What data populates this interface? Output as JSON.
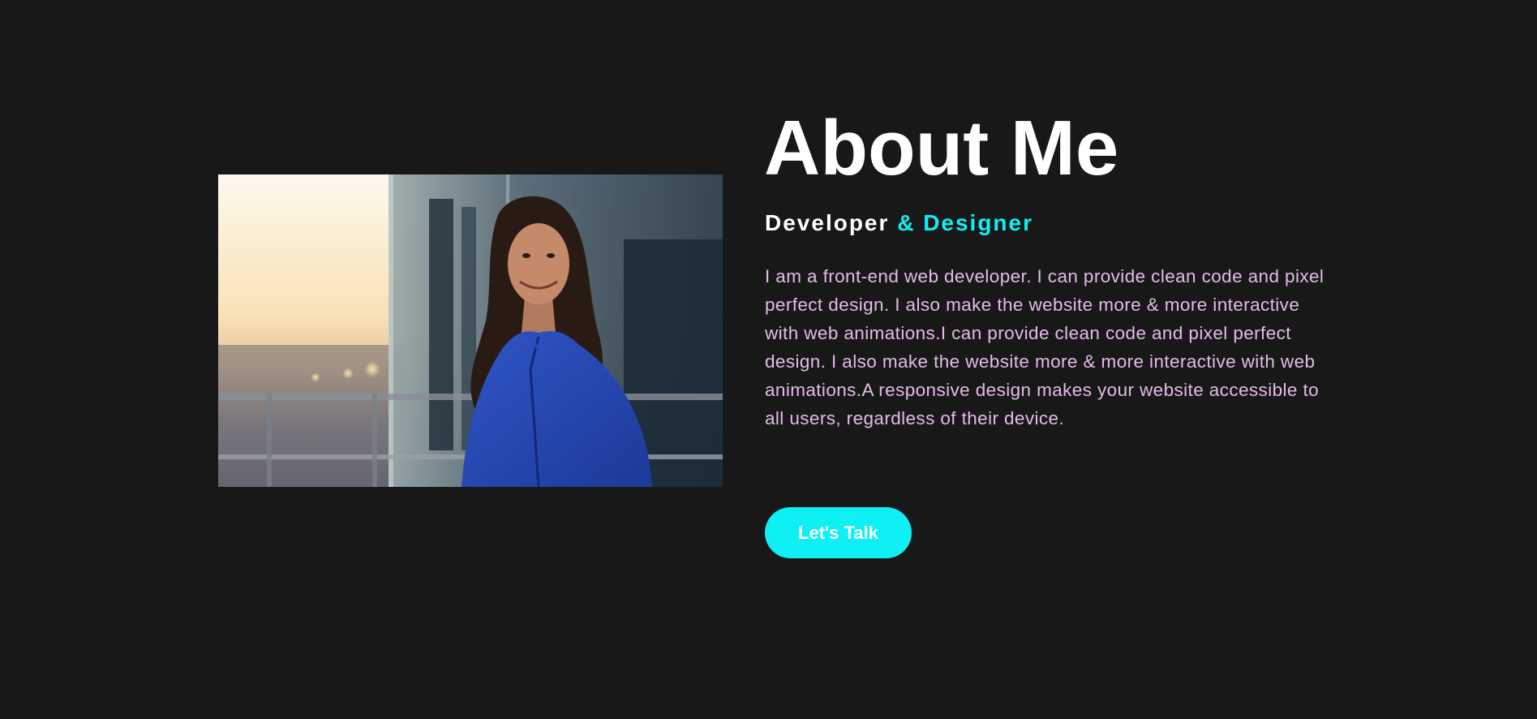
{
  "about": {
    "title": "About Me",
    "subtitle_primary": "Developer",
    "subtitle_accent": "& Designer",
    "description": "I am a front-end web developer. I can provide clean code and pixel perfect design. I also make the website more & more interactive with web animations.I can provide clean code and pixel perfect design. I also make the website more & more interactive with web animations.A responsive design makes your website accessible to all users, regardless of their device.",
    "cta_label": "Let's Talk"
  },
  "colors": {
    "background": "#181818",
    "accent": "#0ef0f4",
    "heading": "#ffffff",
    "body_text": "#e2bde6"
  }
}
